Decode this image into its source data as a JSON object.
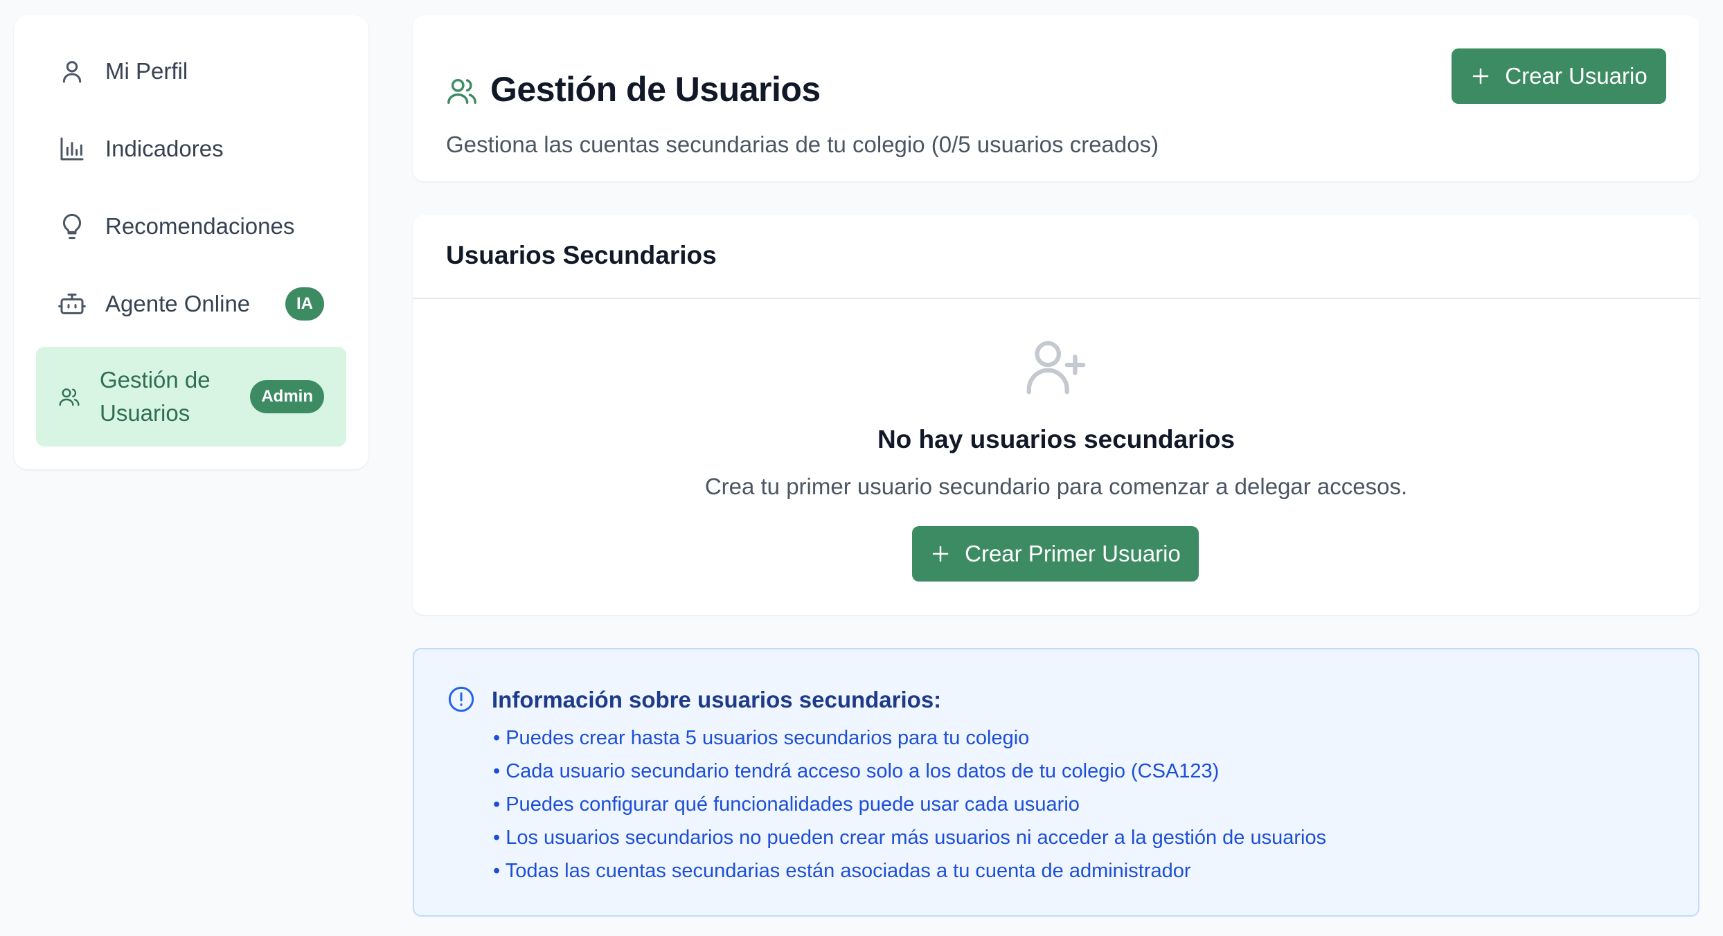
{
  "sidebar": {
    "items": [
      {
        "label": "Mi Perfil",
        "icon": "user-icon"
      },
      {
        "label": "Indicadores",
        "icon": "bar-chart-icon"
      },
      {
        "label": "Recomendaciones",
        "icon": "lightbulb-icon"
      },
      {
        "label": "Agente Online",
        "icon": "bot-icon",
        "badge": "IA"
      },
      {
        "label": "Gestión de Usuarios",
        "icon": "users-icon",
        "badge": "Admin",
        "active": true
      }
    ]
  },
  "header": {
    "title": "Gestión de Usuarios",
    "subtitle": "Gestiona las cuentas secundarias de tu colegio (0/5 usuarios creados)",
    "create_button": "Crear Usuario"
  },
  "users_card": {
    "title": "Usuarios Secundarios",
    "empty_title": "No hay usuarios secundarios",
    "empty_description": "Crea tu primer usuario secundario para comenzar a delegar accesos.",
    "create_first_button": "Crear Primer Usuario"
  },
  "info": {
    "title": "Información sobre usuarios secundarios:",
    "items": [
      "Puedes crear hasta 5 usuarios secundarios para tu colegio",
      "Cada usuario secundario tendrá acceso solo a los datos de tu colegio (CSA123)",
      "Puedes configurar qué funcionalidades puede usar cada usuario",
      "Los usuarios secundarios no pueden crear más usuarios ni acceder a la gestión de usuarios",
      "Todas las cuentas secundarias están asociadas a tu cuenta de administrador"
    ]
  },
  "colors": {
    "accent": "#3d8b63",
    "active_bg": "#d8f5e3",
    "info_bg": "#eff6ff",
    "info_text": "#1d4ed8"
  }
}
